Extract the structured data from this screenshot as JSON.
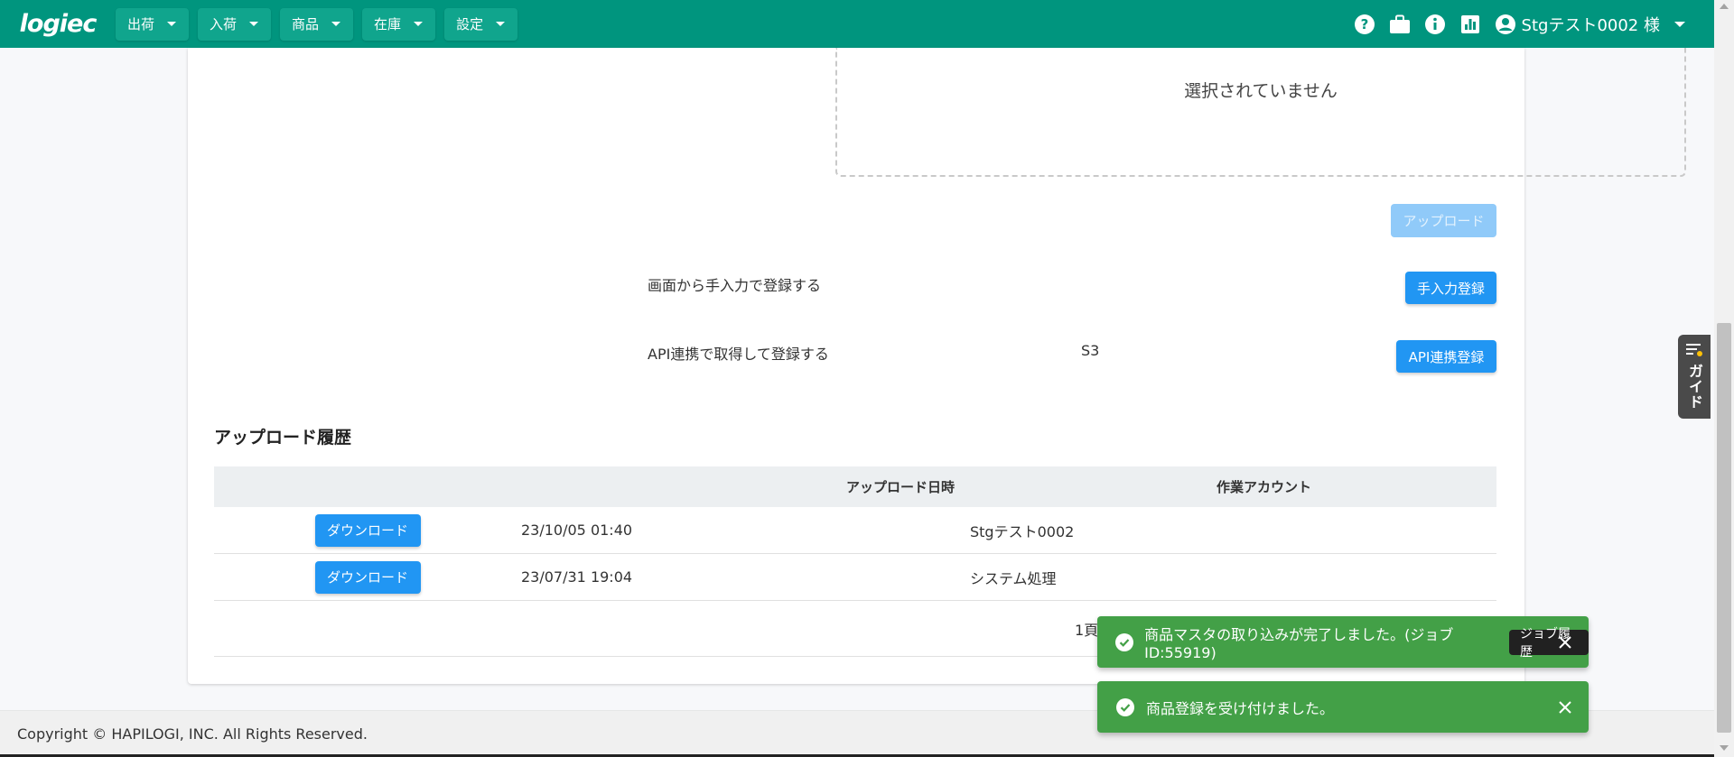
{
  "header": {
    "logo": "logiec",
    "nav": [
      {
        "label": "出荷"
      },
      {
        "label": "入荷"
      },
      {
        "label": "商品"
      },
      {
        "label": "在庫"
      },
      {
        "label": "設定"
      }
    ],
    "icons": [
      "help-icon",
      "briefcase-icon",
      "info-icon",
      "chart-icon",
      "account-icon"
    ],
    "user_label": "Stgテスト0002 様",
    "color": "#00957e"
  },
  "upload": {
    "dropzone_text": "選択されていません",
    "upload_button": "アップロード",
    "manual_text": "画面から手入力で登録する",
    "manual_button": "手入力登録",
    "api_text": "API連携で取得して登録する",
    "api_source": "S3",
    "api_button": "API連携登録"
  },
  "history": {
    "title": "アップロード履歴",
    "columns": [
      "",
      "アップロード日時",
      "作業アカウント"
    ],
    "rows": [
      {
        "button": "ダウンロード",
        "datetime": "23/10/05 01:40",
        "account": "Stgテスト0002"
      },
      {
        "button": "ダウンロード",
        "datetime": "23/07/31 19:04",
        "account": "システム処理"
      }
    ],
    "pagination": "1頁表示"
  },
  "guide": {
    "label": "ガイド"
  },
  "footer": {
    "copyright": "Copyright © HAPILOGI, INC. All Rights Reserved."
  },
  "toasts": [
    {
      "message": "商品マスタの取り込みが完了しました。(ジョブID:55919)",
      "action": "ジョブ履歴"
    },
    {
      "message": "商品登録を受け付けました。"
    }
  ]
}
